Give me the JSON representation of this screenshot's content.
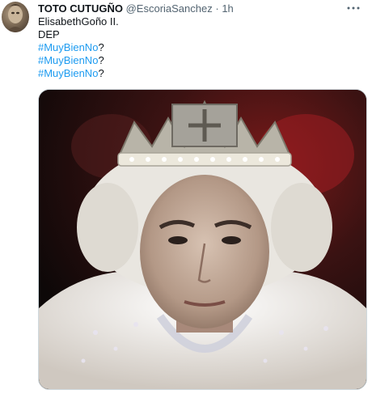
{
  "tweet": {
    "author_name": "TOTO CUTUGÑO",
    "author_handle": "@EscoriaSanchez",
    "separator": "·",
    "time": "1h",
    "more_icon": "more-icon",
    "text_lines": [
      {
        "text": "ElisabethGoño II."
      },
      {
        "text": "DEP"
      },
      {
        "hashtag": "#MuyBienNo",
        "suffix": "?"
      },
      {
        "hashtag": "#MuyBienNo",
        "suffix": "?"
      },
      {
        "hashtag": "#MuyBienNo",
        "suffix": "?"
      }
    ],
    "hashtag_color": "#1d9bf0"
  }
}
